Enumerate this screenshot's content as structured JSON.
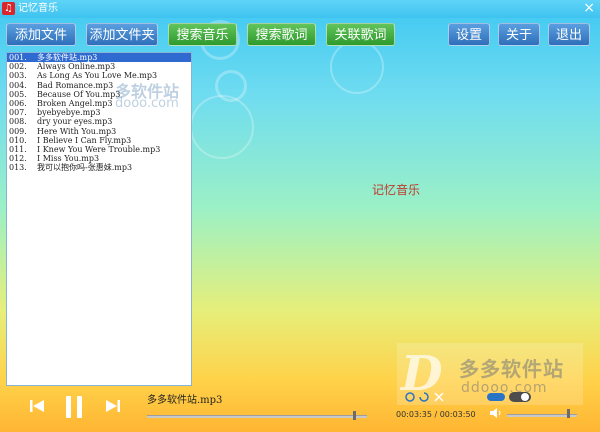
{
  "window": {
    "title": "记忆音乐",
    "close": "×"
  },
  "toolbar": {
    "add_file": "添加文件",
    "add_folder": "添加文件夹",
    "search_music": "搜索音乐",
    "search_lyrics": "搜索歌词",
    "link_lyrics": "关联歌词",
    "settings": "设置",
    "about": "关于",
    "exit": "退出"
  },
  "playlist": [
    {
      "num": "001.",
      "title": "多多软件站.mp3",
      "selected": true
    },
    {
      "num": "002.",
      "title": "Always Online.mp3"
    },
    {
      "num": "003.",
      "title": "As Long As You Love Me.mp3"
    },
    {
      "num": "004.",
      "title": "Bad Romance.mp3"
    },
    {
      "num": "005.",
      "title": "Because Of You.mp3"
    },
    {
      "num": "006.",
      "title": "Broken Angel.mp3"
    },
    {
      "num": "007.",
      "title": "byebyebye.mp3"
    },
    {
      "num": "008.",
      "title": "dry your eyes.mp3"
    },
    {
      "num": "009.",
      "title": "Here With You.mp3"
    },
    {
      "num": "010.",
      "title": "I Believe I Can Fly.mp3"
    },
    {
      "num": "011.",
      "title": "I Knew You Were Trouble.mp3"
    },
    {
      "num": "012.",
      "title": "I Miss You.mp3"
    },
    {
      "num": "013.",
      "title": "我可以抱你吗-张惠妹.mp3"
    }
  ],
  "watermark": {
    "site": "多软件站",
    "url": "dooo.com"
  },
  "main": {
    "center_title": "记忆音乐"
  },
  "logo": {
    "name": "多多软件站",
    "url": "ddooo.com"
  },
  "player": {
    "now_playing": "多多软件站.mp3",
    "time": "00:03:35 / 00:03:50",
    "progress": 0.935,
    "volume": 0.86
  },
  "colors": {
    "button_blue": "#2f6fb9",
    "button_green": "#2e9a2d",
    "selection": "#2f6ad1",
    "title_red": "#c0392b"
  }
}
